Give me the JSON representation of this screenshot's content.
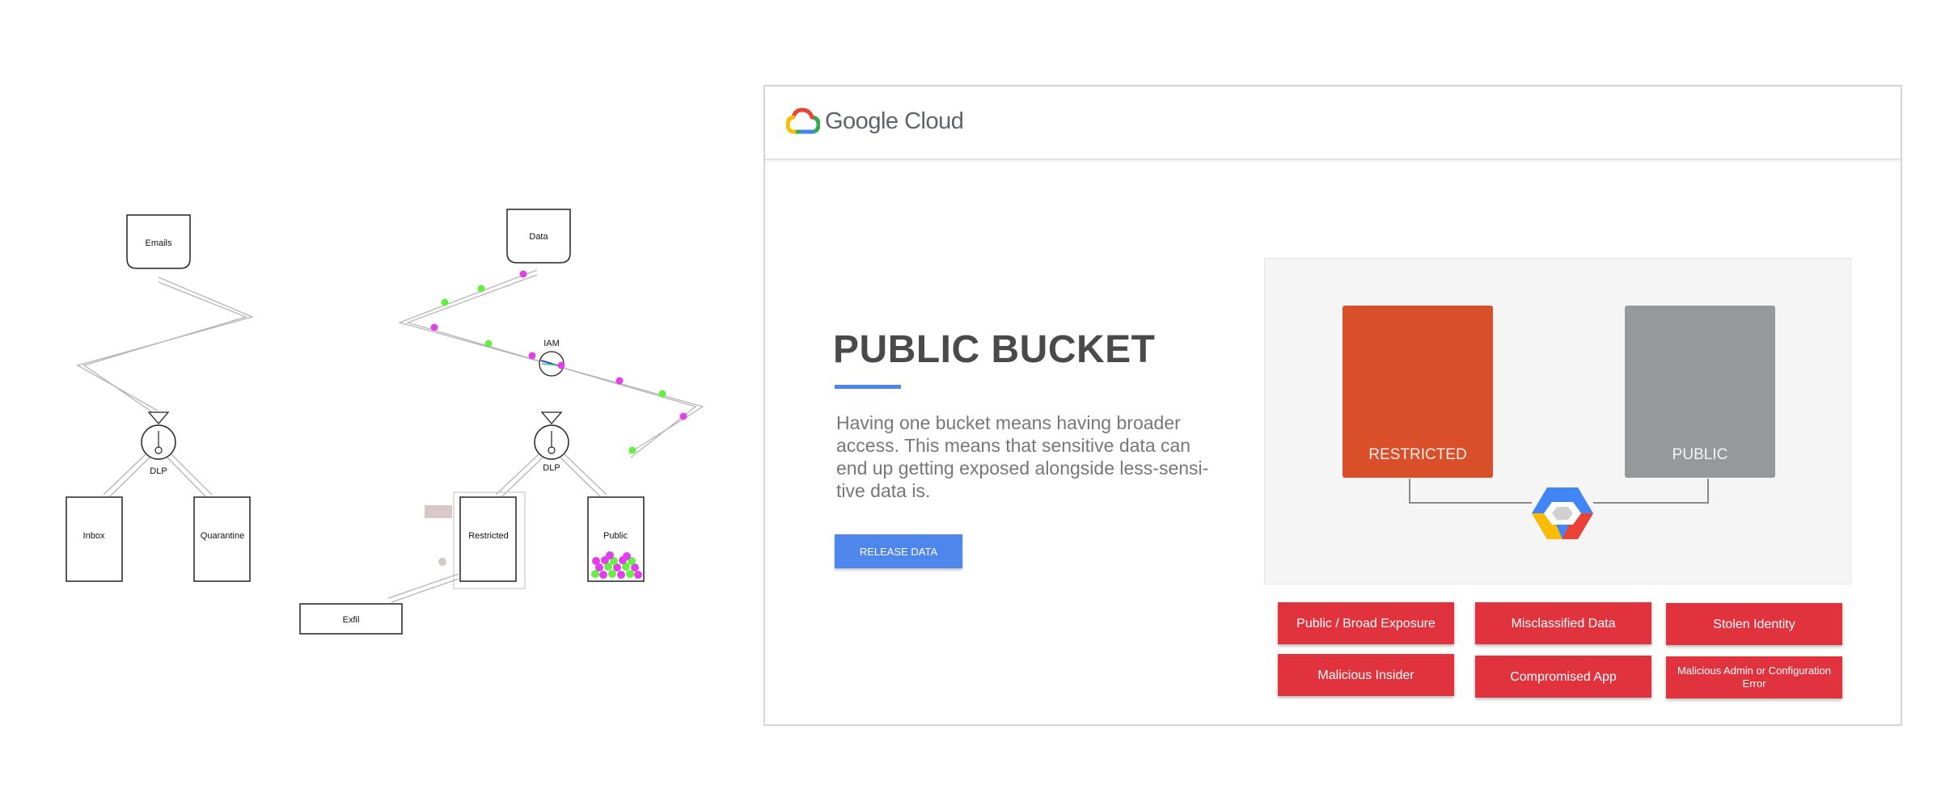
{
  "simulation": {
    "left": {
      "source": "Emails",
      "filter": "DLP",
      "outputs": [
        "Inbox",
        "Quarantine"
      ]
    },
    "right": {
      "source": "Data",
      "gate": "IAM",
      "filter": "DLP",
      "outputs": [
        "Restricted",
        "Public"
      ],
      "exfil": "Exfil"
    },
    "colors": {
      "line": "#bfbfbf",
      "dot_magenta": "#e040e8",
      "dot_green": "#66ee44",
      "faded": "#d8c8c8"
    }
  },
  "panel": {
    "brand": "Google Cloud",
    "heading": "PUBLIC BUCKET",
    "description": "Having one bucket means having broader access. This means that sensitive data can end up getting exposed alongside less-sensi-tive data is.",
    "release_label": "RELEASE DATA",
    "buckets": {
      "restricted": "RESTRICTED",
      "public": "PUBLIC"
    },
    "threats": [
      "Public / Broad Exposure",
      "Misclassified Data",
      "Stolen Identity",
      "Malicious Insider",
      "Compromised App",
      "Malicious Admin or Configuration Error"
    ],
    "colors": {
      "accent": "#4f86ec",
      "restricted": "#d84f2a",
      "public": "#97989a",
      "threat": "#e1333d",
      "google_blue": "#4285f4",
      "google_red": "#ea4335",
      "google_yellow": "#fbbc05",
      "google_green": "#34a853"
    }
  }
}
